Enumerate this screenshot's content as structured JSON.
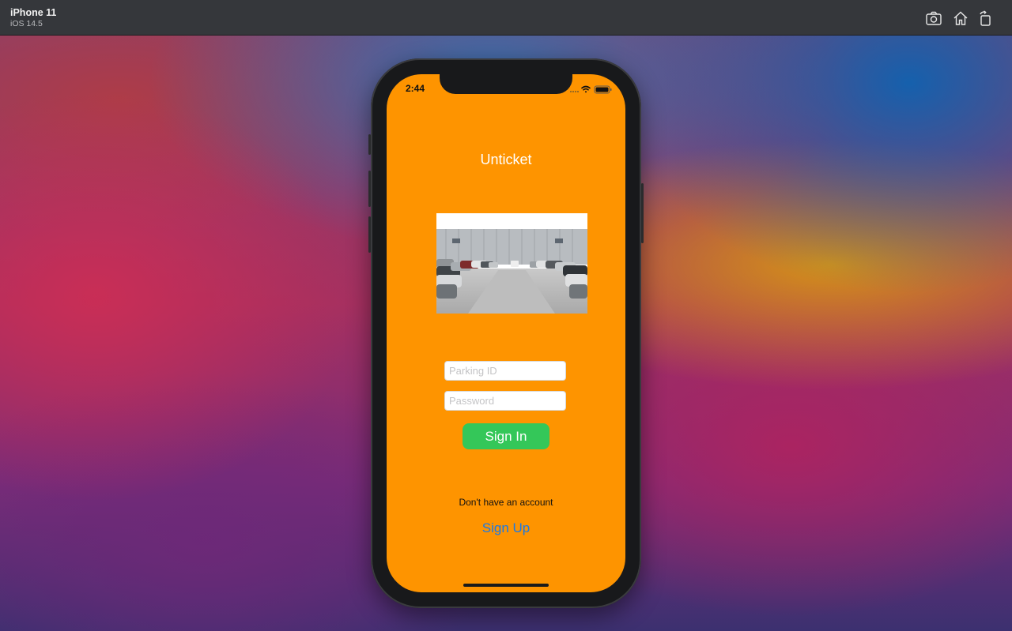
{
  "simulator": {
    "device_name": "iPhone 11",
    "os_version": "iOS 14.5",
    "toolbar_icons": [
      "screenshot-icon",
      "home-icon",
      "rotate-icon"
    ]
  },
  "status_bar": {
    "time": "2:44",
    "icons": [
      "cellular-signal-icon",
      "wifi-icon",
      "battery-icon"
    ]
  },
  "app": {
    "title": "Unticket",
    "hero_image": "parking-lot-photo",
    "parking_id": {
      "placeholder": "Parking ID",
      "value": ""
    },
    "password": {
      "placeholder": "Password",
      "value": ""
    },
    "sign_in_label": "Sign In",
    "no_account_text": "Don't have an account",
    "sign_up_label": "Sign Up"
  },
  "colors": {
    "screen_background": "#fe9400",
    "sign_in_button": "#34c759",
    "sign_up_link": "#1b79e6",
    "title_text": "#ffffff"
  }
}
